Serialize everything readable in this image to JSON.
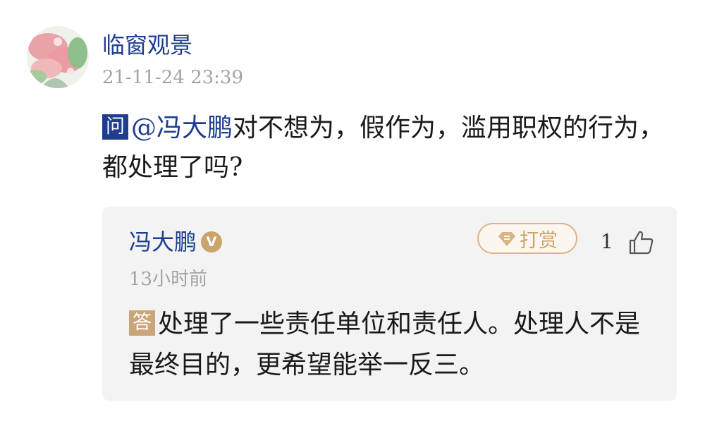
{
  "question_post": {
    "asker_name": "临窗观景",
    "timestamp": "21-11-24 23:39",
    "badge": "问",
    "mention": "@冯大鹏",
    "question_text": "对不想为，假作为，滥用职权的行为，都处理了吗?"
  },
  "reply": {
    "replier_name": "冯大鹏",
    "verified_icon": "verified-v-icon",
    "verified_mark": "V",
    "reward_label": "打赏",
    "like_count": "1",
    "relative_time": "13小时前",
    "badge": "答",
    "answer_text": "处理了一些责任单位和责任人。处理人不是最终目的，更希望能举一反三。"
  },
  "colors": {
    "name_blue": "#1f3d8f",
    "answer_badge": "#cba57a",
    "reward_gold": "#c9a56a",
    "card_bg": "#f3f3f3",
    "meta_gray": "#a3a3a3"
  }
}
